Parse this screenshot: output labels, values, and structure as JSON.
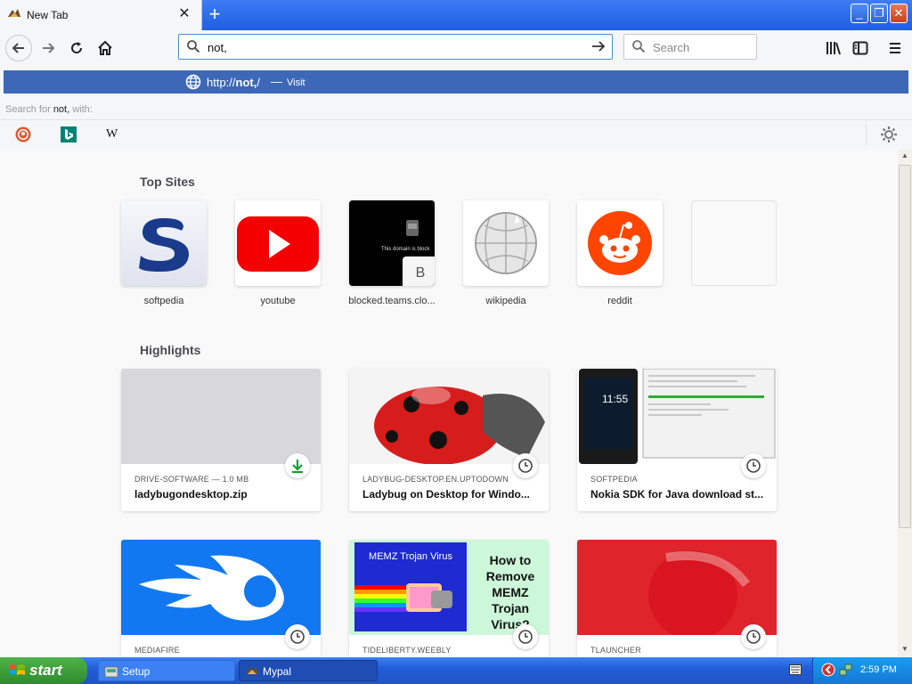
{
  "tab": {
    "title": "New Tab",
    "close": "✕",
    "new_tab": "+"
  },
  "window_controls": {
    "minimize": "_",
    "restore": "❐",
    "close": "✕"
  },
  "navbar": {
    "url_value": "not,",
    "search_placeholder": "Search"
  },
  "autocomplete": {
    "url_prefix": "http://",
    "url_bold": "not,",
    "url_suffix": "/",
    "separator": "—",
    "action": "Visit",
    "search_for_prefix": "Search for ",
    "search_for_term": "not,",
    "search_for_suffix": " with:",
    "engines": [
      "duckduckgo-icon",
      "bing-icon",
      "wikipedia-icon"
    ],
    "wikipedia_glyph": "W"
  },
  "top_sites": {
    "heading": "Top Sites",
    "items": [
      {
        "label": "softpedia",
        "letter": "S"
      },
      {
        "label": "youtube"
      },
      {
        "label": "blocked.teams.clo...",
        "letter": "B",
        "thumb_text": "This domain is block"
      },
      {
        "label": "wikipedia"
      },
      {
        "label": "reddit"
      },
      {
        "label": ""
      }
    ]
  },
  "highlights": {
    "heading": "Highlights",
    "items": [
      {
        "source": "DRIVE-SOFTWARE — 1.0 MB",
        "title": "ladybugondesktop.zip",
        "badge": "download-icon"
      },
      {
        "source": "LADYBUG-DESKTOP.EN.UPTODOWN",
        "title": "Ladybug on Desktop for Windo...",
        "badge": "clock-icon"
      },
      {
        "source": "SOFTPEDIA",
        "title": "Nokia SDK for Java download st...",
        "badge": "clock-icon",
        "phone_time": "11:55"
      },
      {
        "source": "MEDIAFIRE",
        "title": "",
        "badge": "clock-icon"
      },
      {
        "source": "TIDELIBERTY.WEEBLY",
        "title": "",
        "badge": "clock-icon",
        "thumb_heading": "MEMZ Trojan Virus",
        "thumb_text": "How to Remove MEMZ Trojan Virus?"
      },
      {
        "source": "TLAUNCHER",
        "title": "",
        "badge": "clock-icon"
      }
    ]
  },
  "taskbar": {
    "start": "start",
    "tasks": [
      {
        "label": "Setup"
      },
      {
        "label": "Mypal"
      }
    ],
    "clock": "2:59 PM"
  },
  "colors": {
    "accent": "#3d68b8",
    "taskbar": "#225dd6",
    "start": "#2f8b2c",
    "download": "#12a430"
  }
}
